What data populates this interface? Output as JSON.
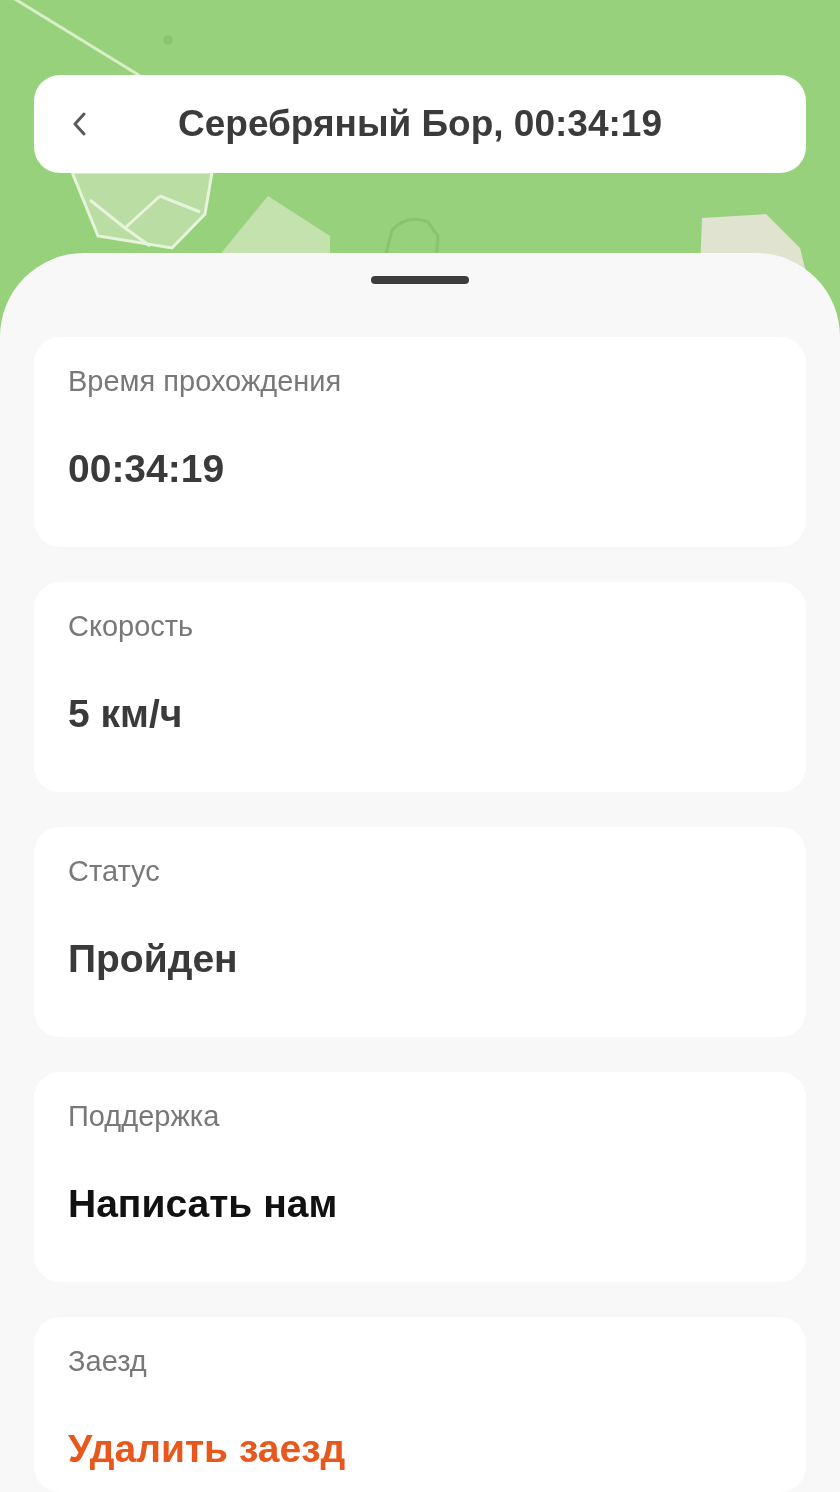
{
  "header": {
    "title": "Серебряный Бор, 00:34:19"
  },
  "details": [
    {
      "label": "Время прохождения",
      "value": "00:34:19",
      "kind": "value"
    },
    {
      "label": "Скорость",
      "value": "5 км/ч",
      "kind": "value"
    },
    {
      "label": "Статус",
      "value": "Пройден",
      "kind": "value"
    },
    {
      "label": "Поддержка",
      "value": "Написать нам",
      "kind": "link"
    },
    {
      "label": "Заезд",
      "value": "Удалить заезд",
      "kind": "danger"
    }
  ]
}
